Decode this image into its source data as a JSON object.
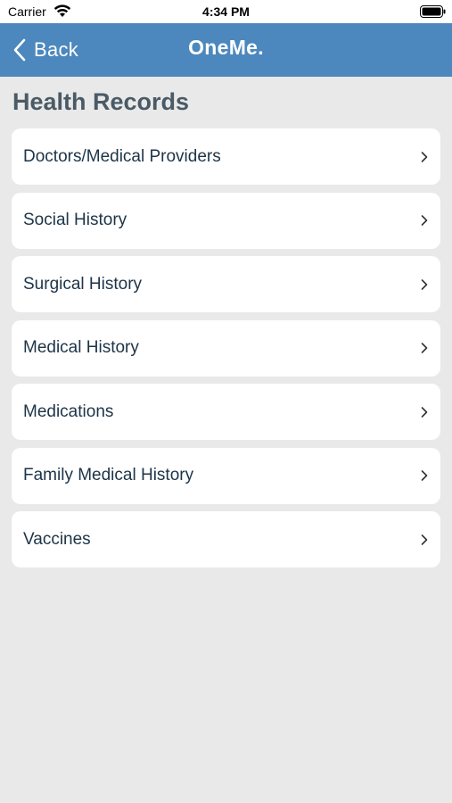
{
  "status_bar": {
    "carrier": "Carrier",
    "time": "4:34 PM",
    "icons": [
      "wifi-icon",
      "battery-icon"
    ]
  },
  "nav": {
    "back_label": "Back",
    "logo_text": "OneMe.",
    "back_icon": "chevron-left-icon"
  },
  "page": {
    "title": "Health Records"
  },
  "records": [
    {
      "label": "Doctors/Medical Providers"
    },
    {
      "label": "Social History"
    },
    {
      "label": "Surgical History"
    },
    {
      "label": "Medical History"
    },
    {
      "label": "Medications"
    },
    {
      "label": "Family Medical History"
    },
    {
      "label": "Vaccines"
    }
  ],
  "colors": {
    "nav_background": "#4c88bd",
    "page_background": "#e9e9e9",
    "title": "#4a5a66",
    "item_text": "#1d3447"
  }
}
